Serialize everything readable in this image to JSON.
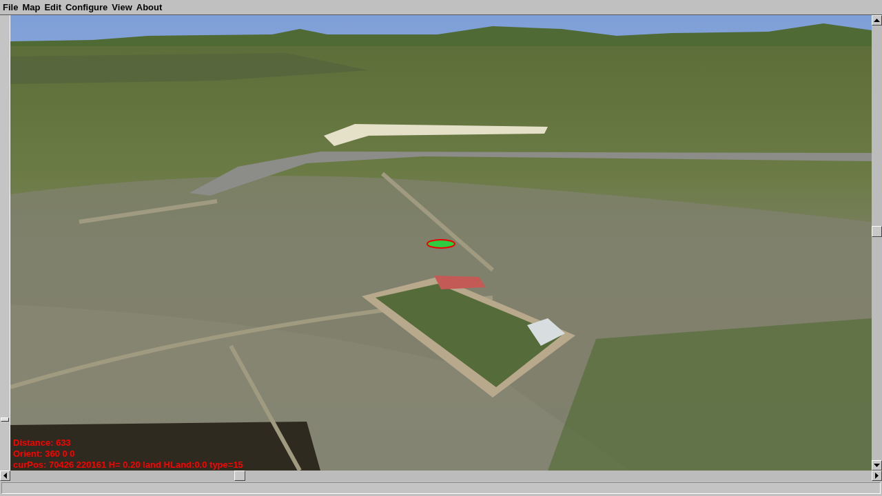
{
  "menu": [
    "File",
    "Map",
    "Edit",
    "Configure",
    "View",
    "About"
  ],
  "overlay": [
    "Distance: 633",
    "Orient: 360 0 0",
    "curPos: 70426 220161 H= 0.20 land HLand:0.0 type=15"
  ]
}
